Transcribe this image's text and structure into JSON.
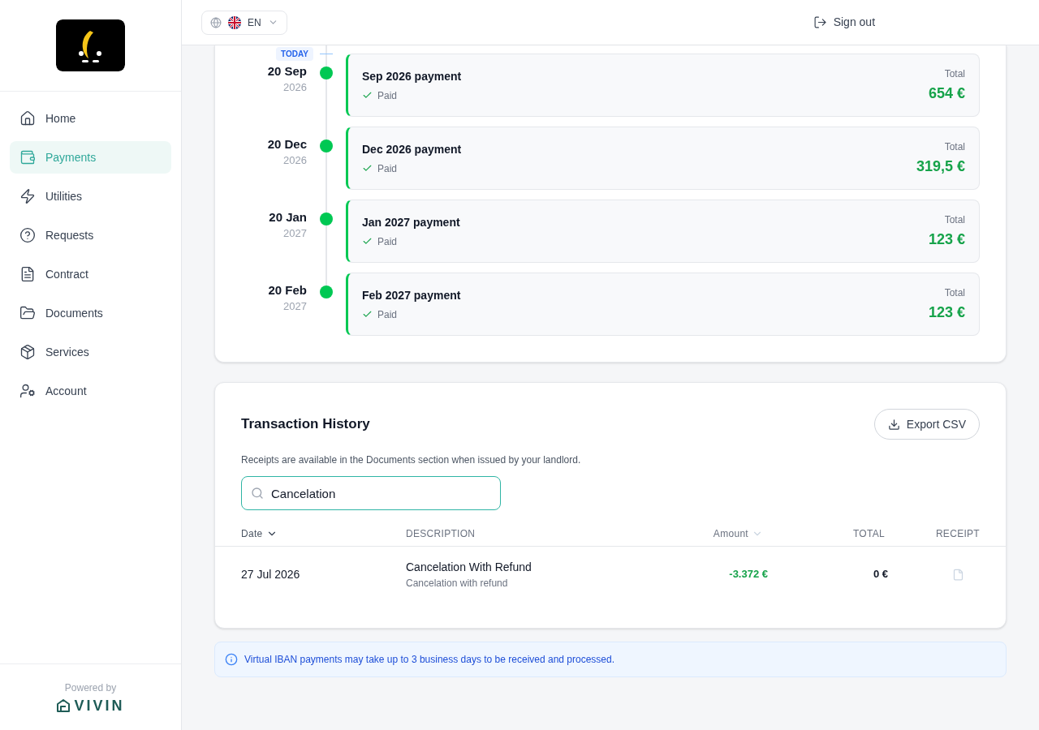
{
  "sidebar": {
    "items": [
      {
        "label": "Home",
        "selected": false
      },
      {
        "label": "Payments",
        "selected": true
      },
      {
        "label": "Utilities",
        "selected": false
      },
      {
        "label": "Requests",
        "selected": false
      },
      {
        "label": "Contract",
        "selected": false
      },
      {
        "label": "Documents",
        "selected": false
      },
      {
        "label": "Services",
        "selected": false
      },
      {
        "label": "Account",
        "selected": false
      }
    ],
    "powered_by": "Powered by",
    "brand": "VIVIN"
  },
  "header": {
    "language": "EN",
    "sign_out": "Sign out"
  },
  "timeline": {
    "today_label": "TODAY",
    "entries": [
      {
        "date": "20 Sep",
        "year": "2026",
        "title": "Sep 2026 payment",
        "status": "Paid",
        "total_label": "Total",
        "total": "654 €",
        "today": true
      },
      {
        "date": "20 Dec",
        "year": "2026",
        "title": "Dec 2026 payment",
        "status": "Paid",
        "total_label": "Total",
        "total": "319,5 €",
        "today": false
      },
      {
        "date": "20 Jan",
        "year": "2027",
        "title": "Jan 2027 payment",
        "status": "Paid",
        "total_label": "Total",
        "total": "123 €",
        "today": false
      },
      {
        "date": "20 Feb",
        "year": "2027",
        "title": "Feb 2027 payment",
        "status": "Paid",
        "total_label": "Total",
        "total": "123 €",
        "today": false
      }
    ]
  },
  "transactions": {
    "title": "Transaction History",
    "export": "Export CSV",
    "note": "Receipts are available in the Documents section when issued by your landlord.",
    "search": {
      "value": "Cancelation"
    },
    "columns": [
      {
        "label": "Date",
        "sortable": true,
        "selected": true
      },
      {
        "label": "DESCRIPTION",
        "sortable": false,
        "selected": false
      },
      {
        "label": "Amount",
        "sortable": true,
        "selected": false
      },
      {
        "label": "TOTAL",
        "sortable": false,
        "selected": false
      },
      {
        "label": "RECEIPT",
        "sortable": false,
        "selected": false
      }
    ],
    "rows": [
      {
        "date": "27 Jul 2026",
        "description": "Cancelation With Refund",
        "detail": "Cancelation with refund",
        "amount": "-3.372 €",
        "total": "0 €"
      }
    ]
  },
  "info": "Virtual IBAN payments may take up to 3 business days to be received and processed."
}
